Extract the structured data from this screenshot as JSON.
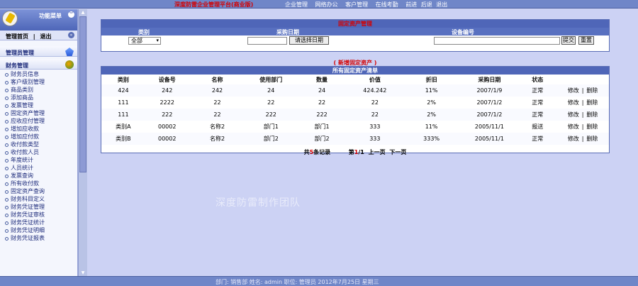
{
  "top": {
    "title": "深度防雷企业管理平台(商业版)",
    "nav": [
      "企业管理",
      "网络办公",
      "客户管理",
      "在线考勤",
      "前进",
      "后退",
      "退出"
    ]
  },
  "sidebar": {
    "menu_label": "功能菜单",
    "sub_home": "管理首页",
    "sub_sep": "|",
    "sub_exit": "退出",
    "section_admin": "管理员管理",
    "section_finance": "财务管理",
    "items": [
      "财务员信息",
      "客户级别管理",
      "商品类别",
      "添加商品",
      "发票管理",
      "固定资产管理",
      "应收应付管理",
      "增加应收款",
      "增加应付款",
      "收付款类型",
      "收付款人员",
      "年度统计",
      "人员统计",
      "发票查询",
      "所有收付款",
      "固定资产查询",
      "财务科目定义",
      "财务凭证管理",
      "财务凭证审核",
      "财务凭证统计",
      "财务凭证明细",
      "财务凭证报表"
    ]
  },
  "search": {
    "title": "固定资产管理",
    "col_type": "类别",
    "col_date": "采购日期",
    "col_no": "设备编号",
    "type_value": "全部",
    "date_button": "请选择日期",
    "submit": "提交",
    "reset": "重置"
  },
  "add_link": "( 新增固定资产 )",
  "list": {
    "title": "所有固定资产清单",
    "headers": [
      "类别",
      "设备号",
      "名称",
      "使用部门",
      "数量",
      "价值",
      "折旧",
      "采购日期",
      "状态",
      ""
    ],
    "rows": [
      [
        "424",
        "242",
        "242",
        "24",
        "24",
        "424.242",
        "11%",
        "2007/1/9",
        "正常"
      ],
      [
        "111",
        "2222",
        "22",
        "22",
        "22",
        "22",
        "2%",
        "2007/1/2",
        "正常"
      ],
      [
        "111",
        "222",
        "22",
        "222",
        "222",
        "22",
        "2%",
        "2007/1/2",
        "正常"
      ],
      [
        "类别A",
        "00002",
        "名称2",
        "部门1",
        "部门1",
        "333",
        "11%",
        "2005/11/1",
        "报送"
      ],
      [
        "类别B",
        "00002",
        "名称2",
        "部门2",
        "部门2",
        "333",
        "333%",
        "2005/11/1",
        "正常"
      ]
    ],
    "op_edit": "修改",
    "op_sep": "|",
    "op_delete": "删除"
  },
  "pager": {
    "total_pre": "共",
    "total_num": "5",
    "total_post": "条记录",
    "page_pre": "第",
    "page_cur": "1",
    "page_mid": "/1",
    "prev": "上一页",
    "next": "下一页"
  },
  "watermark": "深度防雷制作团队",
  "status": "部门: 销售部  姓名: admin  职位: 管理员  2012年7月25日 星期三"
}
